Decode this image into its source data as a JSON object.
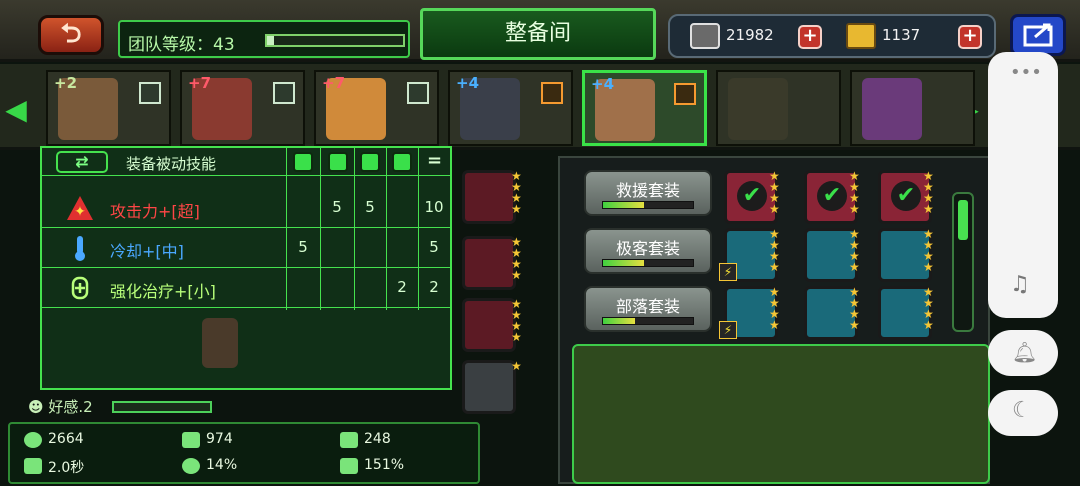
{
  "topbar": {
    "back_icon": "return-arrow-icon",
    "team_level_label": "团队等级：43",
    "title": "整备间",
    "currency1_value": "21982",
    "currency2_value": "1137",
    "plus": "+"
  },
  "heroes": [
    {
      "plus": "+2",
      "plus_color": "#c8e8a0",
      "portrait_color": "#7a5a3a"
    },
    {
      "plus": "+7",
      "plus_color": "#ff5a6a",
      "portrait_color": "#8a3a30"
    },
    {
      "plus": "+7",
      "plus_color": "#ff5a6a",
      "portrait_color": "#d08a3a"
    },
    {
      "plus": "+4",
      "plus_color": "#4ab0ff",
      "portrait_color": "#3a3f4a"
    },
    {
      "plus": "+4",
      "plus_color": "#4ab0ff",
      "portrait_color": "#a0704a"
    },
    {
      "plus": "",
      "plus_color": "#ffffff",
      "portrait_color": "#3a3a2a"
    },
    {
      "plus": "",
      "plus_color": "#ffffff",
      "portrait_color": "#6a3a7a"
    }
  ],
  "skills": {
    "title": "装备被动技能",
    "swap_icon": "⇄",
    "equals": "=",
    "rows": [
      {
        "label": "攻击力+[超]",
        "color": "#ff4646",
        "values": [
          "",
          "5",
          "5",
          "",
          "10"
        ]
      },
      {
        "label": "冷却+[中]",
        "color": "#4aa8ff",
        "values": [
          "5",
          "",
          "",
          "",
          "5"
        ]
      },
      {
        "label": "强化治疗+[小]",
        "color": "#b8ff7a",
        "values": [
          "",
          "",
          "",
          "2",
          "2"
        ]
      }
    ]
  },
  "favor": {
    "label": "好感.2",
    "level": 0.0
  },
  "stats": {
    "hp": "2664",
    "attack": "974",
    "defense": "248",
    "speed": "2.0秒",
    "crit": "14%",
    "crit_dmg": "151%"
  },
  "sets": [
    {
      "name": "救援套装",
      "progress": 0.45
    },
    {
      "name": "极客套装",
      "progress": 0.45
    },
    {
      "name": "部落套装",
      "progress": 0.35
    }
  ],
  "colors": {
    "accent": "#45e24e",
    "panel": "#123418"
  }
}
